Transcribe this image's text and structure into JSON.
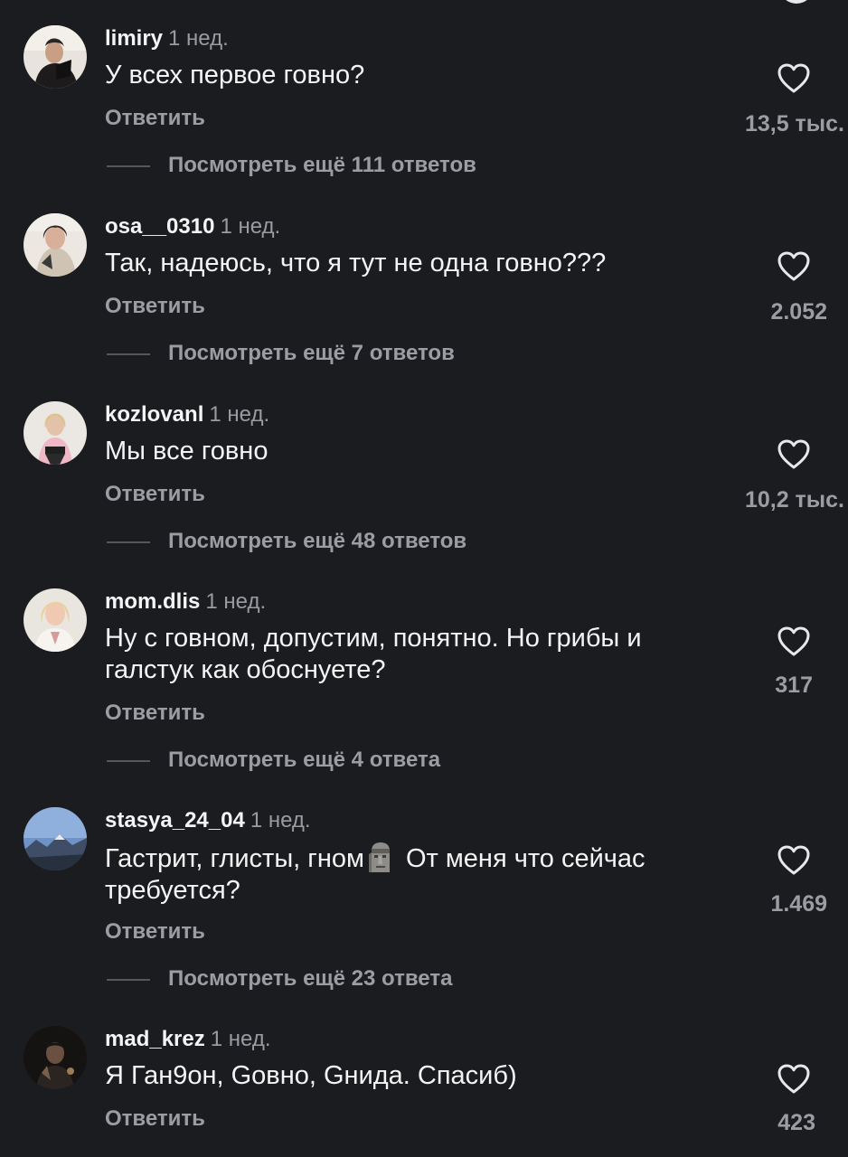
{
  "comments": [
    {
      "username": "limiry",
      "time": "1 нед.",
      "text": "У всех первое говно?",
      "reply_label": "Ответить",
      "likes": "13,5 тыс.",
      "view_more": "Посмотреть ещё 111 ответов",
      "avatar_icon": "avatar-photo"
    },
    {
      "username": "osa__0310",
      "time": "1 нед.",
      "text": "Так, надеюсь, что я тут не одна говно???",
      "reply_label": "Ответить",
      "likes": "2.052",
      "view_more": "Посмотреть ещё 7 ответов",
      "avatar_icon": "avatar-photo"
    },
    {
      "username": "kozlovanl",
      "time": "1 нед.",
      "text": "Мы все говно",
      "reply_label": "Ответить",
      "likes": "10,2 тыс.",
      "view_more": "Посмотреть ещё 48 ответов",
      "avatar_icon": "avatar-photo"
    },
    {
      "username": "mom.dlis",
      "time": "1 нед.",
      "text": "Ну с говном, допустим, понятно. Но грибы и галстук как обоснуете?",
      "reply_label": "Ответить",
      "likes": "317",
      "view_more": "Посмотреть ещё 4 ответа",
      "avatar_icon": "avatar-photo"
    },
    {
      "username": "stasya_24_04",
      "time": "1 нед.",
      "text_before_emoji": "Гастрит, глисты, гном",
      "emoji": "moai-emoji",
      "text_after_emoji": "От меня что сейчас требуется?",
      "reply_label": "Ответить",
      "likes": "1.469",
      "view_more": "Посмотреть ещё 23 ответа",
      "avatar_icon": "avatar-photo"
    },
    {
      "username": "mad_krez",
      "time": "1 нед.",
      "text": "Я Ган9он, Gовно, Gнида. Спасиб)",
      "reply_label": "Ответить",
      "likes": "423",
      "avatar_icon": "avatar-photo"
    }
  ],
  "icons": {
    "like": "heart-outline-icon",
    "top_partial": "circle-icon"
  },
  "colors": {
    "background": "#1b1c20",
    "primary_text": "#f4f4f5",
    "secondary_text": "#9c9da3"
  }
}
